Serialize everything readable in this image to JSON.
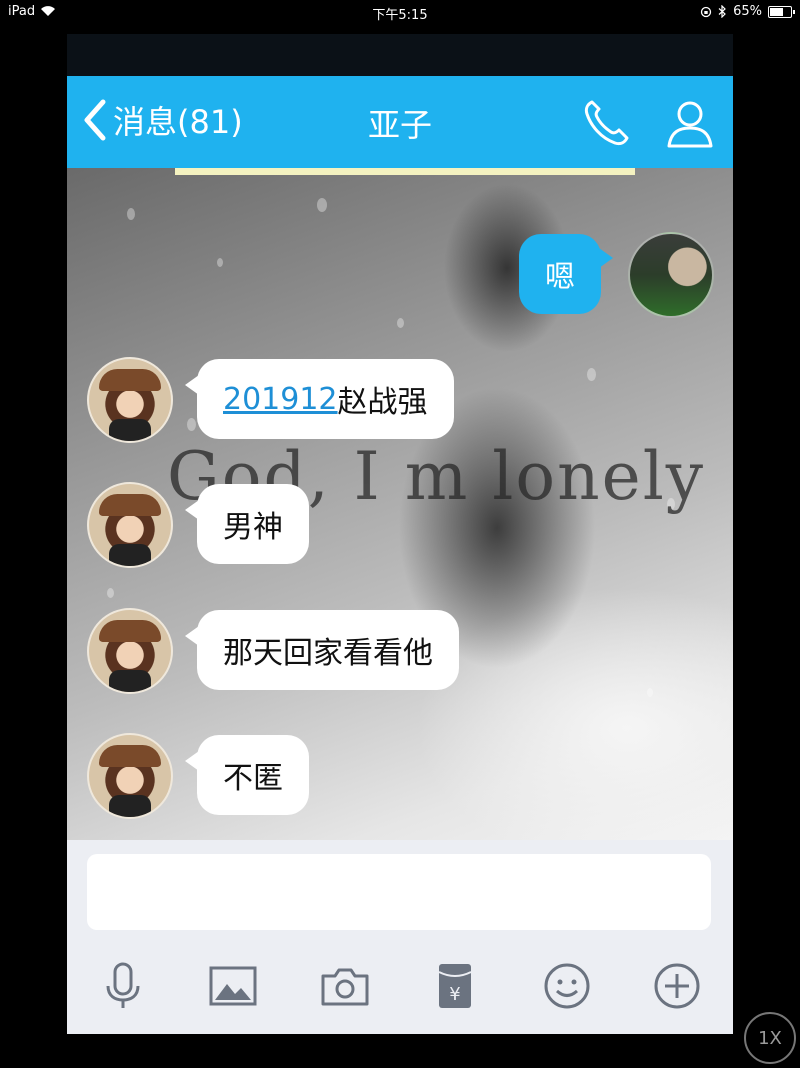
{
  "status_bar": {
    "device": "iPad",
    "time": "下午5:15",
    "battery_percent": "65%",
    "battery_level": 0.65
  },
  "nav": {
    "back_label": "消息(81)",
    "title": "亚子"
  },
  "messages": [
    {
      "from": "me",
      "text": "嗯"
    },
    {
      "from": "other",
      "link": "201912",
      "text": "赵战强"
    },
    {
      "from": "other",
      "text": "男神"
    },
    {
      "from": "other",
      "text": "那天回家看看他"
    },
    {
      "from": "other",
      "text": "不匿"
    }
  ],
  "wallpaper_text": "God, I m lonely",
  "input": {
    "placeholder": ""
  },
  "tools": [
    "microphone-icon",
    "image-icon",
    "camera-icon",
    "red-packet-icon",
    "emoji-icon",
    "plus-icon"
  ],
  "zoom": {
    "label": "1X"
  },
  "colors": {
    "accent": "#1fb2ef",
    "link": "#1e8fd6",
    "input_bg": "#eceef3"
  }
}
